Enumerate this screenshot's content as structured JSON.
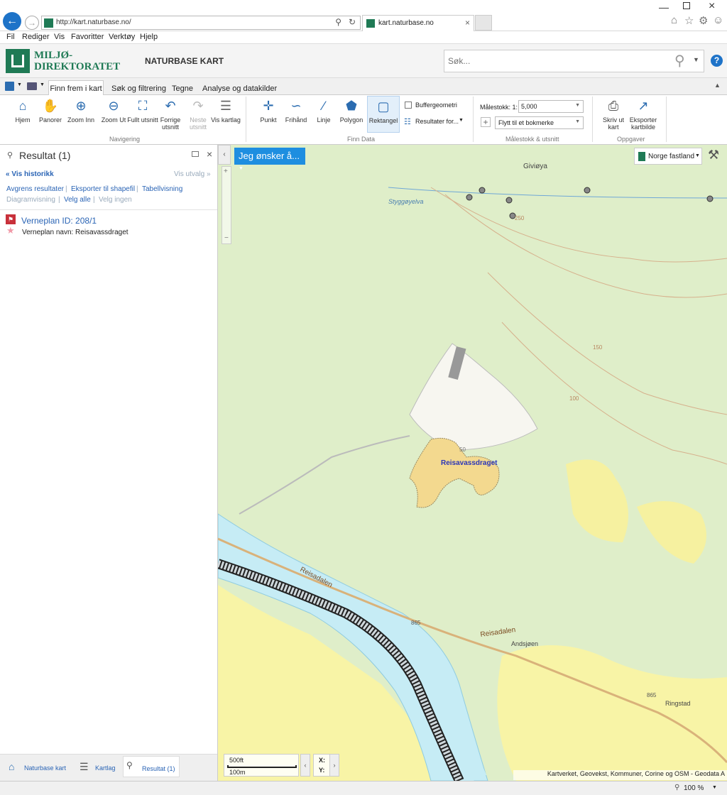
{
  "browser": {
    "url": "http://kart.naturbase.no/",
    "tab_title": "kart.naturbase.no"
  },
  "menu": [
    "Fil",
    "Rediger",
    "Vis",
    "Favoritter",
    "Verktøy",
    "Hjelp"
  ],
  "header": {
    "logo_line1": "MILJØ-",
    "logo_line2": "DIREKTORATET",
    "app_title": "NATURBASE KART",
    "search_placeholder": "Søk...",
    "help": "?"
  },
  "ribbon_tabs": [
    "Finn frem i kart",
    "Søk og filtrering",
    "Tegne",
    "Analyse og datakilder"
  ],
  "ribbon": {
    "nav": [
      {
        "label": "Hjem",
        "icon": "home-icon"
      },
      {
        "label": "Panorer",
        "icon": "hand-icon"
      },
      {
        "label": "Zoom Inn",
        "icon": "zoom-in-icon"
      },
      {
        "label": "Zoom Ut",
        "icon": "zoom-out-icon"
      },
      {
        "label": "Fullt utsnitt",
        "icon": "full-extent-icon"
      },
      {
        "label": "Forrige utsnitt",
        "icon": "back-icon"
      },
      {
        "label": "Neste utsnitt",
        "icon": "forward-icon"
      },
      {
        "label": "Vis kartlag",
        "icon": "layers-icon"
      }
    ],
    "nav_group": "Navigering",
    "find": [
      {
        "label": "Punkt",
        "icon": "point-icon"
      },
      {
        "label": "Frihånd",
        "icon": "freehand-icon"
      },
      {
        "label": "Linje",
        "icon": "line-icon"
      },
      {
        "label": "Polygon",
        "icon": "polygon-icon"
      },
      {
        "label": "Rektangel",
        "icon": "rectangle-icon"
      }
    ],
    "buffer_label": "Buffergeometri",
    "results_for": "Resultater for...",
    "find_group": "Finn Data",
    "scale_label": "Målestokk: 1:",
    "scale_value": "5,000",
    "bookmark_placeholder": "Flytt til et bokmerke",
    "scale_group": "Målestokk & utsnitt",
    "tasks": [
      {
        "label": "Skriv ut kart",
        "icon": "print-icon"
      },
      {
        "label": "Eksporter kartbilde",
        "icon": "export-icon"
      }
    ],
    "tasks_group": "Oppgaver"
  },
  "side": {
    "title": "Resultat (1)",
    "history": "Vis historikk",
    "selection": "Vis utvalg",
    "actions": [
      "Avgrens resultater",
      "Eksporter til shapefil",
      "Tabellvisning"
    ],
    "actions2": [
      "Diagramvisning",
      "Velg alle",
      "Velg ingen"
    ],
    "result_title": "Verneplan ID: 208/1",
    "result_detail": "Verneplan navn: Reisavassdraget",
    "bottom_tabs": [
      "Naturbase kart",
      "Kartlag",
      "Resultat (1)"
    ]
  },
  "map": {
    "jeg_button": "Jeg ønsker å...",
    "basemap": "Norge fastland",
    "labels": {
      "area": "Reisavassdraget",
      "river": "Styggøyelva",
      "island": "Giviøya",
      "valley1": "Reisadalen",
      "valley2": "Reisadalen",
      "place1": "Andsjøen",
      "place2": "Ringstad",
      "road1": "865",
      "road2": "865",
      "contour150": "150",
      "contour100": "100",
      "contour50": "50",
      "contour250": "250"
    },
    "scale_ft": "500ft",
    "scale_m": "100m",
    "coord_x": "X:",
    "coord_y": "Y:",
    "attribution": "Kartverket, Geovekst, Kommuner, Corine og OSM - Geodata A"
  },
  "status": {
    "zoom": "100 %"
  }
}
